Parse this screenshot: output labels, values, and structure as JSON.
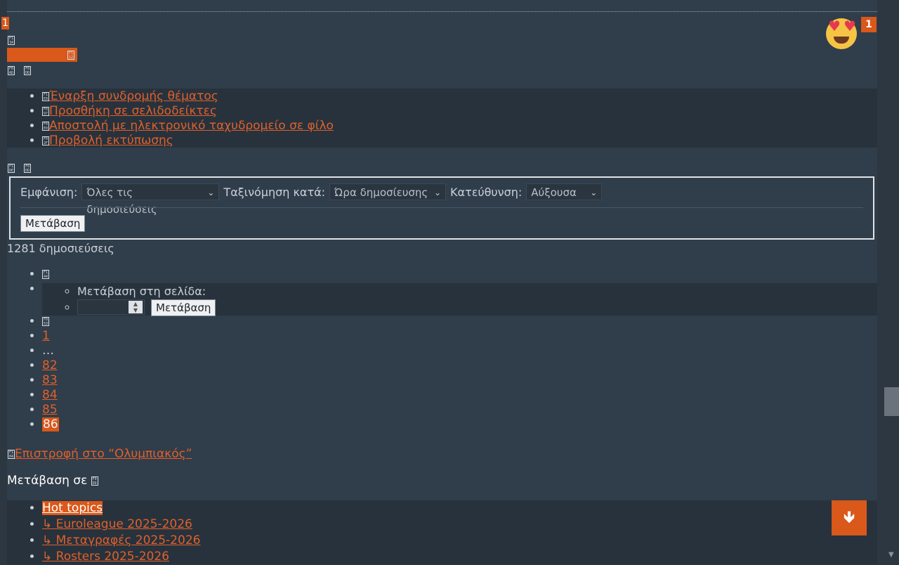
{
  "top": {
    "corner_badge": "1",
    "reaction_count": "1",
    "reaction_icon": "heart-eyes-emoji"
  },
  "tofu": {
    "t1": "F1 34",
    "t2": "F1 12",
    "t3": "F0 AD",
    "t4": "F0 DD",
    "t5": "F1 E8",
    "t6": "F0 97",
    "t7": "F0 E0",
    "t8": "F0 2F",
    "t9": "F1 DE",
    "t10": "F0 DD",
    "t11": "F1 44",
    "t12": "F0 53",
    "t13": "F1 04",
    "t14": "F0 DD"
  },
  "topic_tools": [
    "Έναρξη συνδρομής θέματος",
    "Προσθήκη σε σελιδοδείκτες",
    "Αποστολή με ηλεκτρονικό ταχυδρομείο σε φίλο",
    "Προβολή εκτύπωσης"
  ],
  "filter": {
    "display_label": "Εμφάνιση:",
    "display_value": "Όλες τις δημοσιεύσεις",
    "sort_label": "Ταξινόμηση κατά:",
    "sort_value": "Ώρα δημοσίευσης",
    "direction_label": "Κατεύθυνση:",
    "direction_value": "Αύξουσα",
    "go_button": "Μετάβαση"
  },
  "post_count": "1281 δημοσιεύσεις",
  "pagination": {
    "jump_label": "Μετάβαση στη σελίδα:",
    "jump_input_value": "",
    "jump_button": "Μετάβαση",
    "pages": [
      "1",
      "…",
      "82",
      "83",
      "84",
      "85",
      "86"
    ],
    "current": "86"
  },
  "back_link": "Επιστροφή στο “Ολυμπιακός”",
  "jump_to_label": "Μετάβαση σε",
  "forums": [
    "Hot topics",
    "↳   Euroleague 2025-2026",
    "↳   Μεταγραφές 2025-2026",
    "↳   Rosters 2025-2026"
  ],
  "colors": {
    "accent": "#d9581a",
    "background": "#2c3742",
    "panel": "#303d4a"
  }
}
